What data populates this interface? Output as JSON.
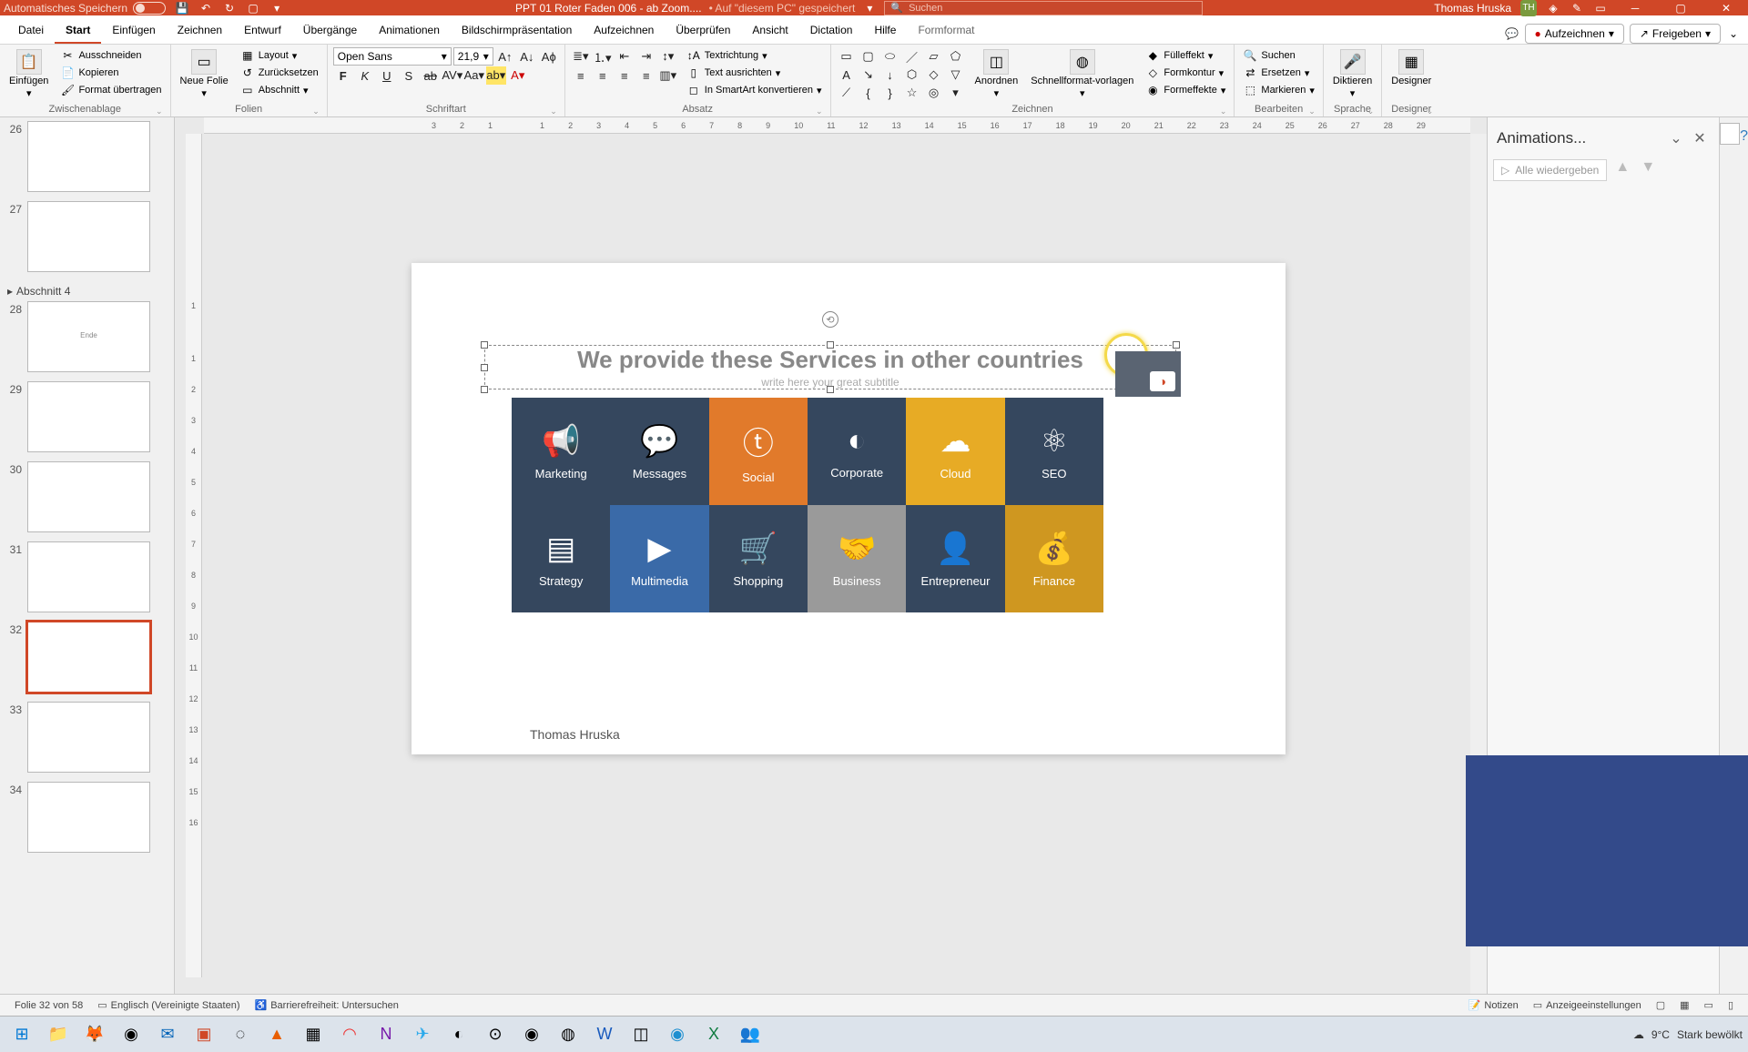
{
  "titlebar": {
    "autosave_label": "Automatisches Speichern",
    "doc_name": "PPT 01 Roter Faden 006 - ab Zoom....",
    "save_location": "• Auf \"diesem PC\" gespeichert",
    "search_placeholder": "Suchen",
    "user_name": "Thomas Hruska",
    "user_initials": "TH"
  },
  "tabs": {
    "file": "Datei",
    "start": "Start",
    "insert": "Einfügen",
    "draw": "Zeichnen",
    "design": "Entwurf",
    "transitions": "Übergänge",
    "animations": "Animationen",
    "slideshow": "Bildschirmpräsentation",
    "record": "Aufzeichnen",
    "review": "Überprüfen",
    "view": "Ansicht",
    "dictation": "Dictation",
    "help": "Hilfe",
    "shapeformat": "Formformat",
    "record_btn": "Aufzeichnen",
    "share_btn": "Freigeben"
  },
  "ribbon": {
    "clipboard": {
      "label": "Zwischenablage",
      "paste": "Einfügen",
      "cut": "Ausschneiden",
      "copy": "Kopieren",
      "format": "Format übertragen"
    },
    "slides": {
      "label": "Folien",
      "new": "Neue Folie",
      "layout": "Layout",
      "reset": "Zurücksetzen",
      "section": "Abschnitt"
    },
    "font": {
      "label": "Schriftart",
      "name": "Open Sans",
      "size": "21,9"
    },
    "paragraph": {
      "label": "Absatz",
      "textdir": "Textrichtung",
      "align": "Text ausrichten",
      "smartart": "In SmartArt konvertieren"
    },
    "drawing": {
      "label": "Zeichnen",
      "arrange": "Anordnen",
      "quickstyles": "Schnellformat-vorlagen",
      "fill": "Fülleffekt",
      "outline": "Formkontur",
      "effects": "Formeffekte"
    },
    "editing": {
      "label": "Bearbeiten",
      "find": "Suchen",
      "replace": "Ersetzen",
      "select": "Markieren"
    },
    "voice": {
      "label": "Sprache",
      "dictate": "Diktieren"
    },
    "designer": {
      "label": "Designer",
      "btn": "Designer"
    }
  },
  "thumbs": {
    "section": "Abschnitt 4",
    "items": [
      {
        "no": "26"
      },
      {
        "no": "27"
      },
      {
        "no": "28",
        "label": "Ende"
      },
      {
        "no": "29"
      },
      {
        "no": "30"
      },
      {
        "no": "31"
      },
      {
        "no": "32"
      },
      {
        "no": "33"
      },
      {
        "no": "34"
      }
    ]
  },
  "slide": {
    "title": "We provide these Services in other countries",
    "subtitle": "write here your great subtitle",
    "author": "Thomas Hruska",
    "tiles": [
      {
        "label": "Marketing",
        "icon": "📢",
        "cls": "c-navy"
      },
      {
        "label": "Messages",
        "icon": "💬",
        "cls": "c-navy"
      },
      {
        "label": "Social",
        "icon": "ⓣ",
        "cls": "c-orange"
      },
      {
        "label": "Corporate",
        "icon": "◐",
        "cls": "c-navy"
      },
      {
        "label": "Cloud",
        "icon": "☁",
        "cls": "c-yellow"
      },
      {
        "label": "SEO",
        "icon": "⚛",
        "cls": "c-navy"
      },
      {
        "label": "Strategy",
        "icon": "▤",
        "cls": "c-navy"
      },
      {
        "label": "Multimedia",
        "icon": "▶",
        "cls": "c-blue"
      },
      {
        "label": "Shopping",
        "icon": "🛒",
        "cls": "c-navy"
      },
      {
        "label": "Business",
        "icon": "🤝",
        "cls": "c-grey"
      },
      {
        "label": "Entrepreneur",
        "icon": "👤",
        "cls": "c-navy"
      },
      {
        "label": "Finance",
        "icon": "💰",
        "cls": "c-gold"
      }
    ]
  },
  "ruler": {
    "h": [
      "3",
      "2",
      "1",
      "",
      "1",
      "2",
      "3",
      "4",
      "5",
      "6",
      "7",
      "8",
      "9",
      "10",
      "11",
      "12",
      "13",
      "14",
      "15",
      "16",
      "17",
      "18",
      "19",
      "20",
      "21",
      "22",
      "23",
      "24",
      "25",
      "26",
      "27",
      "28",
      "29"
    ],
    "v": [
      "",
      "1",
      "",
      "1",
      "2",
      "3",
      "4",
      "5",
      "6",
      "7",
      "8",
      "9",
      "10",
      "11",
      "12",
      "13",
      "14",
      "15",
      "16"
    ]
  },
  "pane": {
    "title": "Animations...",
    "replay": "Alle wiedergeben"
  },
  "status": {
    "slide": "Folie 32 von 58",
    "lang": "Englisch (Vereinigte Staaten)",
    "access": "Barrierefreiheit: Untersuchen",
    "notes": "Notizen",
    "display": "Anzeigeeinstellungen"
  },
  "weather": {
    "temp": "9°C",
    "desc": "Stark bewölkt"
  }
}
